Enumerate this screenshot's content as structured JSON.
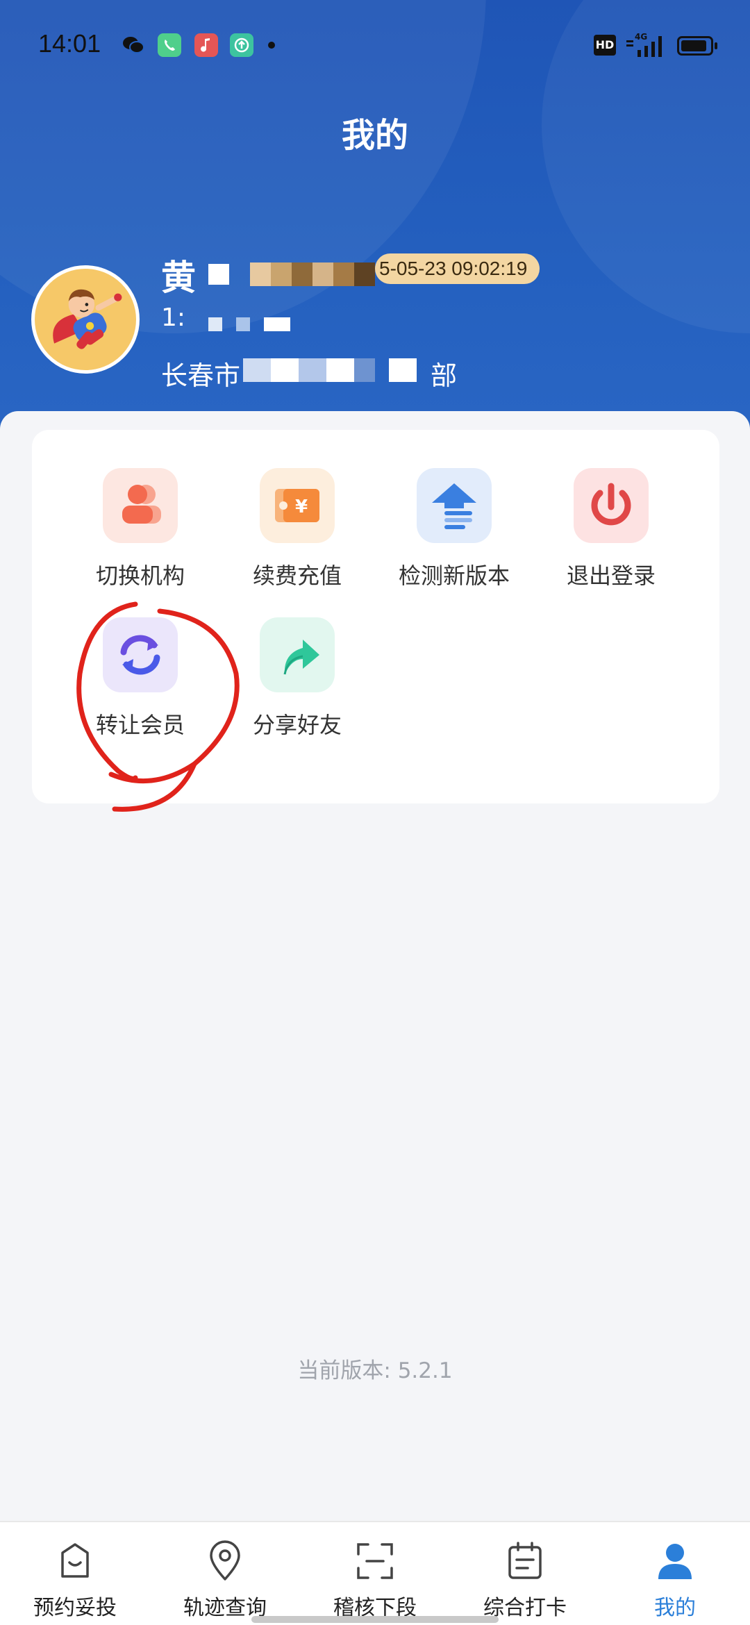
{
  "status_bar": {
    "time": "14:01",
    "hd_label": "HD",
    "network_label": "4G"
  },
  "header": {
    "title": "我的"
  },
  "profile": {
    "name_visible": "黄",
    "date_badge": "5-05-23 09:02:19",
    "phone_visible": "1:",
    "org_visible_start": "长春市",
    "org_visible_end": "部"
  },
  "menu": {
    "items": [
      {
        "label": "切换机构",
        "icon": "switch-org-icon",
        "color": "#f36a4f"
      },
      {
        "label": "续费充值",
        "icon": "recharge-ticket-icon",
        "color": "#f58a3b"
      },
      {
        "label": "检测新版本",
        "icon": "update-arrow-icon",
        "color": "#3a7fe0"
      },
      {
        "label": "退出登录",
        "icon": "power-icon",
        "color": "#e04848"
      },
      {
        "label": "转让会员",
        "icon": "transfer-refresh-icon",
        "color": "#6a4fe0"
      },
      {
        "label": "分享好友",
        "icon": "share-arrow-icon",
        "color": "#2fc79a"
      }
    ]
  },
  "version_text": "当前版本: 5.2.1",
  "tabbar": {
    "tabs": [
      {
        "label": "预约妥投",
        "icon": "bag-smile-icon"
      },
      {
        "label": "轨迹查询",
        "icon": "location-pin-icon"
      },
      {
        "label": "稽核下段",
        "icon": "scan-frame-icon"
      },
      {
        "label": "综合打卡",
        "icon": "calendar-icon"
      },
      {
        "label": "我的",
        "icon": "user-icon",
        "active": true
      }
    ]
  },
  "colors": {
    "header_blue": "#1f55b6",
    "accent_blue": "#2b7fd9",
    "annotation_red": "#e0231b"
  }
}
